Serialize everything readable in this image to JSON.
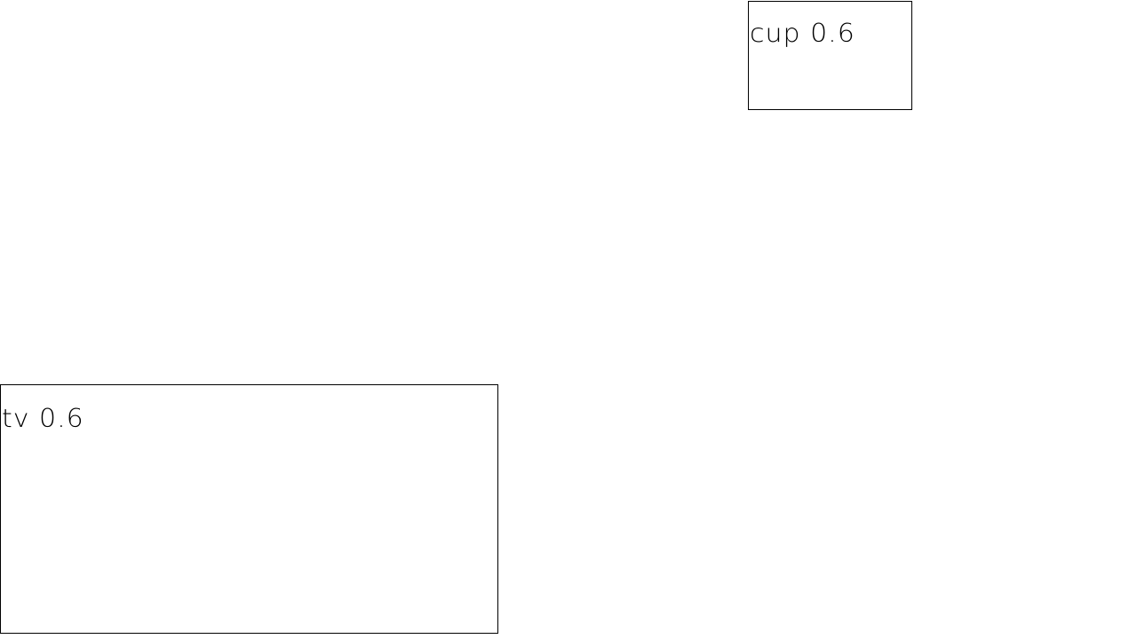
{
  "detections": [
    {
      "id": "cup",
      "label": "cup 0.6"
    },
    {
      "id": "tv",
      "label": "tv 0.6"
    }
  ],
  "colors": {
    "background": "#ffffff",
    "box_stroke": "#000000",
    "label_text": "#000000"
  }
}
